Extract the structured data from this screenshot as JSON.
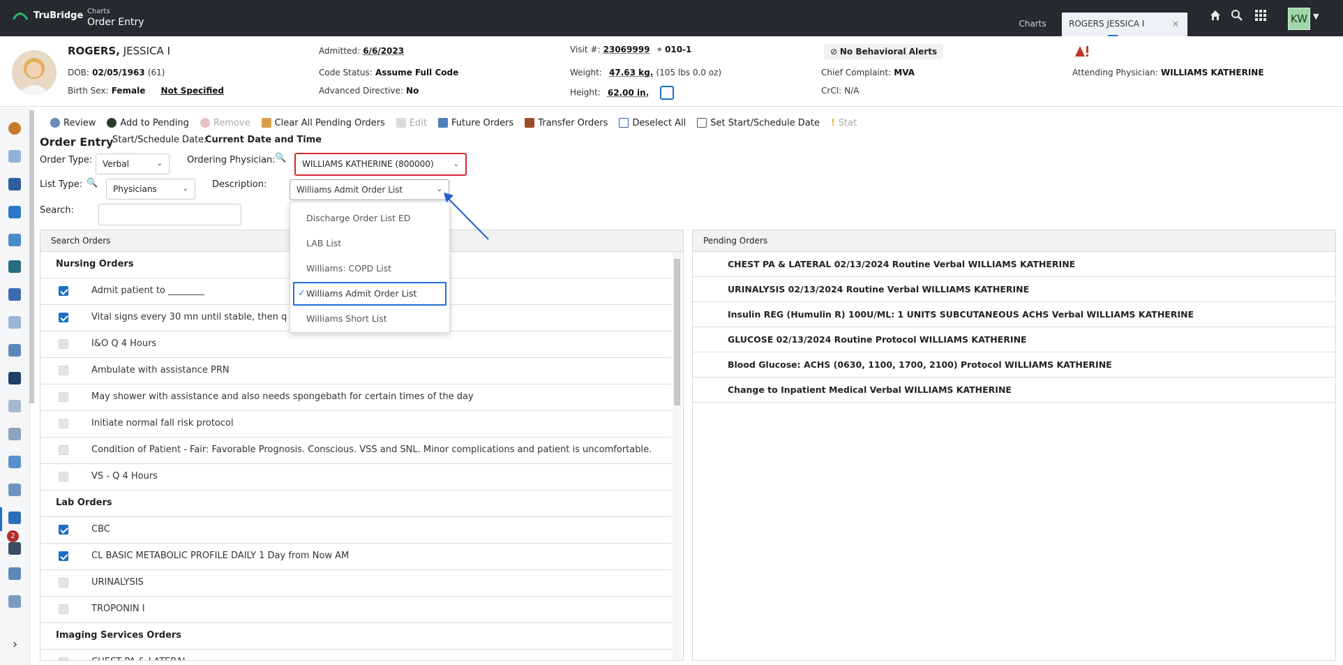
{
  "topbar": {
    "brand": "TruBridge",
    "breadcrumb_parent": "Charts",
    "breadcrumb_current": "Order Entry",
    "tabs": [
      "Charts",
      "ROGERS JESSICA I"
    ],
    "tab_close": "×",
    "user_initials": "KW"
  },
  "patient": {
    "last_name": "ROGERS,",
    "first_name": "JESSICA I",
    "dob_label": "DOB:",
    "dob": "02/05/1963",
    "age": "(61)",
    "birth_sex_label": "Birth Sex:",
    "birth_sex": "Female",
    "not_specified": "Not Specified",
    "admitted_label": "Admitted:",
    "admitted": "6/6/2023",
    "code_status_label": "Code Status:",
    "code_status": "Assume Full Code",
    "adv_directive_label": "Advanced Directive:",
    "adv_directive": "No",
    "visit_label": "Visit #:",
    "visit": "23069999",
    "room": "010-1",
    "weight_label": "Weight:",
    "weight": "47.63 kg.",
    "weight_lbs": "(105 lbs 0.0 oz)",
    "height_label": "Height:",
    "height": "62.00 in.",
    "behavioral": "No Behavioral Alerts",
    "chief_complaint_label": "Chief Complaint:",
    "chief_complaint": "MVA",
    "crcl_label": "CrCl:",
    "crcl": "N/A",
    "attending_label": "Attending Physician:",
    "attending": "WILLIAMS KATHERINE"
  },
  "toolbar": {
    "review": "Review",
    "add_pending": "Add to Pending",
    "remove": "Remove",
    "clear_all": "Clear All Pending Orders",
    "edit": "Edit",
    "future": "Future Orders",
    "transfer": "Transfer Orders",
    "deselect": "Deselect All",
    "set_start": "Set Start/Schedule Date",
    "stat": "Stat"
  },
  "form": {
    "title": "Order Entry",
    "start_label": "Start/Schedule Date:",
    "start_value": "Current Date and Time",
    "order_type_label": "Order Type:",
    "order_type": "Verbal",
    "ordering_physician_label": "Ordering Physician:",
    "ordering_physician": "WILLIAMS KATHERINE (800000)",
    "list_type_label": "List Type:",
    "list_type": "Physicians",
    "description_label": "Description:",
    "description": "Williams Admit Order List",
    "search_label": "Search:",
    "search_value": ""
  },
  "description_options": [
    "Discharge Order List ED",
    "LAB List",
    "Williams: COPD List",
    "Williams Admit Order List",
    "Williams Short List"
  ],
  "search_orders": {
    "title": "Search Orders",
    "groups": [
      {
        "name": "Nursing Orders",
        "items": [
          {
            "label": "Admit patient to ________",
            "checked": true
          },
          {
            "label": "Vital signs every 30 mn until stable, then q 4 hours",
            "checked": true
          },
          {
            "label": "I&O Q 4 Hours",
            "checked": false
          },
          {
            "label": "Ambulate with assistance PRN",
            "checked": false
          },
          {
            "label": "May shower with assistance and also needs spongebath for certain times of the day",
            "checked": false
          },
          {
            "label": "Initiate normal fall risk protocol",
            "checked": false
          },
          {
            "label": "Condition of Patient - Fair: Favorable Prognosis. Conscious. VSS and SNL. Minor complications and patient is uncomfortable.",
            "checked": false
          },
          {
            "label": "VS - Q 4 Hours",
            "checked": false
          }
        ]
      },
      {
        "name": "Lab Orders",
        "items": [
          {
            "label": "CBC",
            "checked": true
          },
          {
            "label": "CL BASIC METABOLIC PROFILE DAILY 1 Day from Now AM",
            "checked": true
          },
          {
            "label": "URINALYSIS",
            "checked": false
          },
          {
            "label": "TROPONIN I",
            "checked": false
          }
        ]
      },
      {
        "name": "Imaging Services Orders",
        "items": [
          {
            "label": "CHEST PA & LATERAL",
            "checked": false
          }
        ]
      }
    ]
  },
  "pending_orders": {
    "title": "Pending Orders",
    "items": [
      "CHEST PA & LATERAL 02/13/2024 Routine Verbal WILLIAMS KATHERINE",
      "URINALYSIS 02/13/2024 Routine Verbal WILLIAMS KATHERINE",
      "Insulin REG (Humulin R) 100U/ML: 1 UNITS SUBCUTANEOUS ACHS Verbal WILLIAMS KATHERINE",
      "GLUCOSE 02/13/2024 Routine Protocol WILLIAMS KATHERINE",
      "Blood Glucose: ACHS (0630, 1100, 1700, 2100) Protocol WILLIAMS KATHERINE",
      "Change to Inpatient Medical Verbal WILLIAMS KATHERINE"
    ]
  },
  "rail": {
    "badge": "2",
    "expand": "›"
  },
  "colors": {
    "accent": "#1d6ec5",
    "topbar": "#262a2f",
    "highlight_border": "#d9262c",
    "arrow": "#1f5fc8"
  }
}
